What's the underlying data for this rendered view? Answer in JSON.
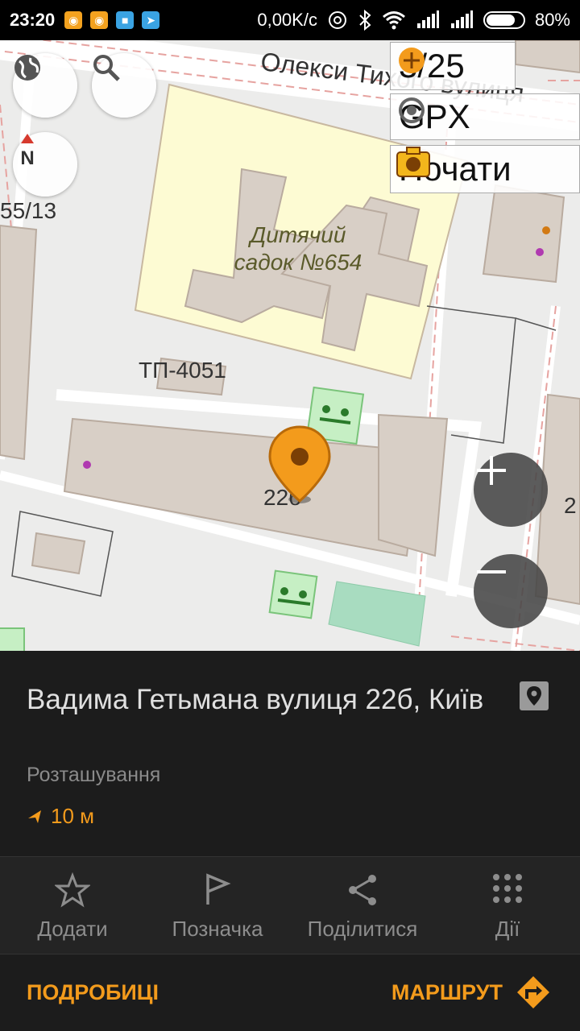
{
  "status_bar": {
    "time": "23:20",
    "net_speed": "0,00K/c",
    "battery": "80%",
    "battery_level": 0.8
  },
  "map": {
    "street_label": "Олекси Тихого вулиця",
    "kindergarten_label": "Дитячий садок №654",
    "substation_label": "ТП-4051",
    "house_number_left": "55/13",
    "house_number_marker": "22б",
    "house_number_right": "2",
    "widgets": {
      "counter": "3/25",
      "gpx": "GPX",
      "photo": "Почати"
    },
    "accent_marker_color": "#f39b1c"
  },
  "place": {
    "address": "Вадима Гетьмана вулиця 22б, Київ",
    "type": "Розташування",
    "distance": "10 м"
  },
  "actions": [
    {
      "label": "Додати",
      "icon": "star-icon"
    },
    {
      "label": "Позначка",
      "icon": "flag-icon"
    },
    {
      "label": "Поділитися",
      "icon": "share-icon"
    },
    {
      "label": "Дії",
      "icon": "dots-grid-icon"
    }
  ],
  "footer": {
    "details": "ПОДРОБИЦІ",
    "route": "МАРШРУТ"
  }
}
